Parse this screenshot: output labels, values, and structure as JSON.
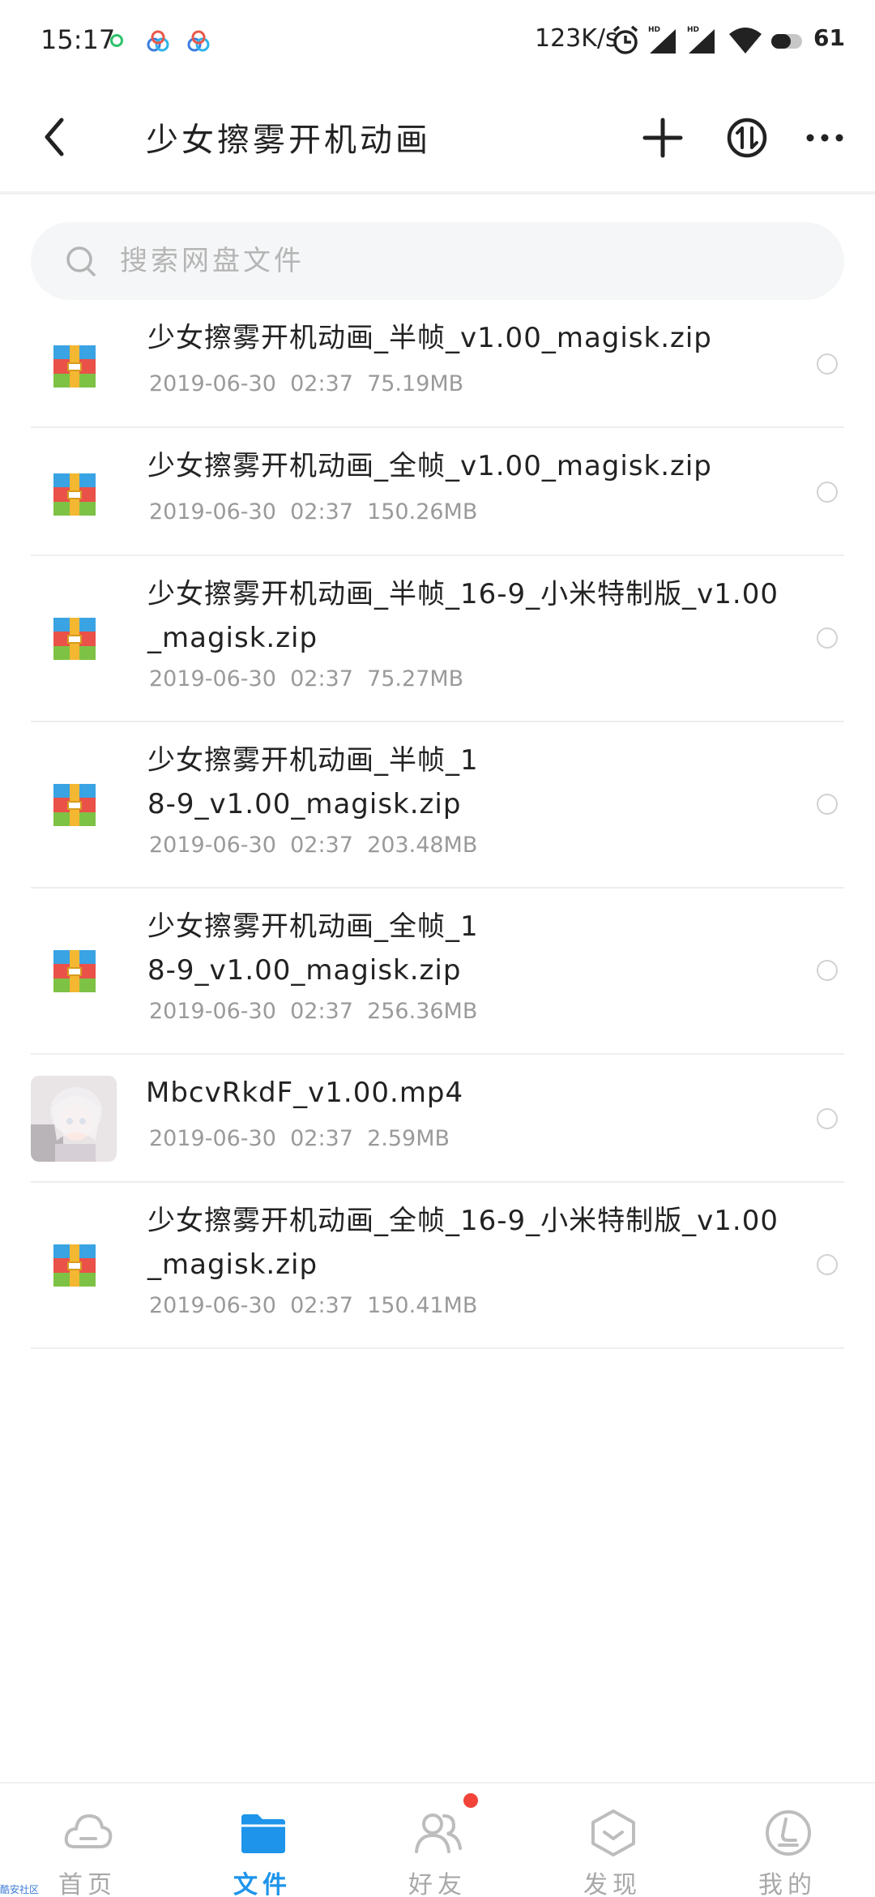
{
  "status_bar": {
    "time": "15:17",
    "network_speed": "123K/s",
    "battery": "61",
    "icons": [
      "wechat-dot-icon",
      "baidu-netdisk-icon",
      "baidu-netdisk-icon",
      "alarm-icon",
      "hd-signal-icon",
      "hd-signal-icon",
      "wifi-icon",
      "battery-icon"
    ]
  },
  "header": {
    "title": "少女擦雾开机动画",
    "back_icon": "back-arrow-icon",
    "add_icon": "plus-icon",
    "transfer_icon": "transfer-icon",
    "more_icon": "more-icon"
  },
  "search": {
    "placeholder": "搜索网盘文件",
    "value": ""
  },
  "files": [
    {
      "name": "少女擦雾开机动画_半帧_v1.00_magisk.zip",
      "date": "2019-06-30",
      "time": "02:37",
      "size": "75.19MB",
      "type": "zip"
    },
    {
      "name": "少女擦雾开机动画_全帧_v1.00_magisk.zip",
      "date": "2019-06-30",
      "time": "02:37",
      "size": "150.26MB",
      "type": "zip"
    },
    {
      "name": "少女擦雾开机动画_半帧_16-9_小米特制版_v1.00_magisk.zip",
      "date": "2019-06-30",
      "time": "02:37",
      "size": "75.27MB",
      "type": "zip"
    },
    {
      "name": "少女擦雾开机动画_半帧_18-9_v1.00_magisk.zip",
      "date": "2019-06-30",
      "time": "02:37",
      "size": "203.48MB",
      "type": "zip"
    },
    {
      "name": "少女擦雾开机动画_全帧_18-9_v1.00_magisk.zip",
      "date": "2019-06-30",
      "time": "02:37",
      "size": "256.36MB",
      "type": "zip"
    },
    {
      "name": "MbcvRkdF_v1.00.mp4",
      "date": "2019-06-30",
      "time": "02:37",
      "size": "2.59MB",
      "type": "video"
    },
    {
      "name": "少女擦雾开机动画_全帧_16-9_小米特制版_v1.00_magisk.zip",
      "date": "2019-06-30",
      "time": "02:37",
      "size": "150.41MB",
      "type": "zip"
    }
  ],
  "bottom_nav": [
    {
      "label": "首页",
      "icon": "cloud-home-icon",
      "active": false
    },
    {
      "label": "文件",
      "icon": "folder-icon",
      "active": true
    },
    {
      "label": "好友",
      "icon": "friends-icon",
      "active": false,
      "badge": true
    },
    {
      "label": "发现",
      "icon": "discover-icon",
      "active": false
    },
    {
      "label": "我的",
      "icon": "profile-icon",
      "active": false
    }
  ],
  "watermark": "酷安社区",
  "colors": {
    "accent": "#1e94ea",
    "badge": "#f3443a",
    "text_primary": "#222222",
    "text_secondary": "#9a9a9a",
    "search_bg": "#f5f6f7"
  }
}
